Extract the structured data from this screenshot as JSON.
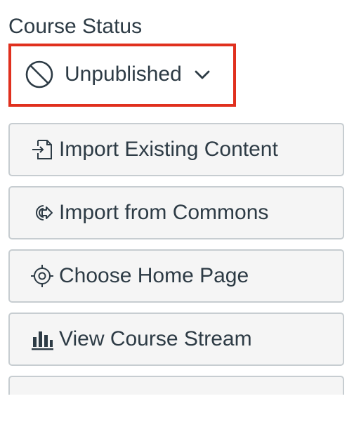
{
  "course_status": {
    "heading": "Course Status",
    "current_status": "Unpublished",
    "status_icon": "unpublished-circle-slash-icon",
    "caret_icon": "chevron-down-icon",
    "highlight_color": "#e0301e"
  },
  "actions": [
    {
      "label": "Import Existing Content",
      "icon": "import-icon"
    },
    {
      "label": "Import from Commons",
      "icon": "commons-icon"
    },
    {
      "label": "Choose Home Page",
      "icon": "target-icon"
    },
    {
      "label": "View Course Stream",
      "icon": "bar-chart-icon"
    }
  ],
  "colors": {
    "text": "#2d3b45",
    "button_bg": "#f5f5f5",
    "button_border": "#c7cdd1"
  }
}
